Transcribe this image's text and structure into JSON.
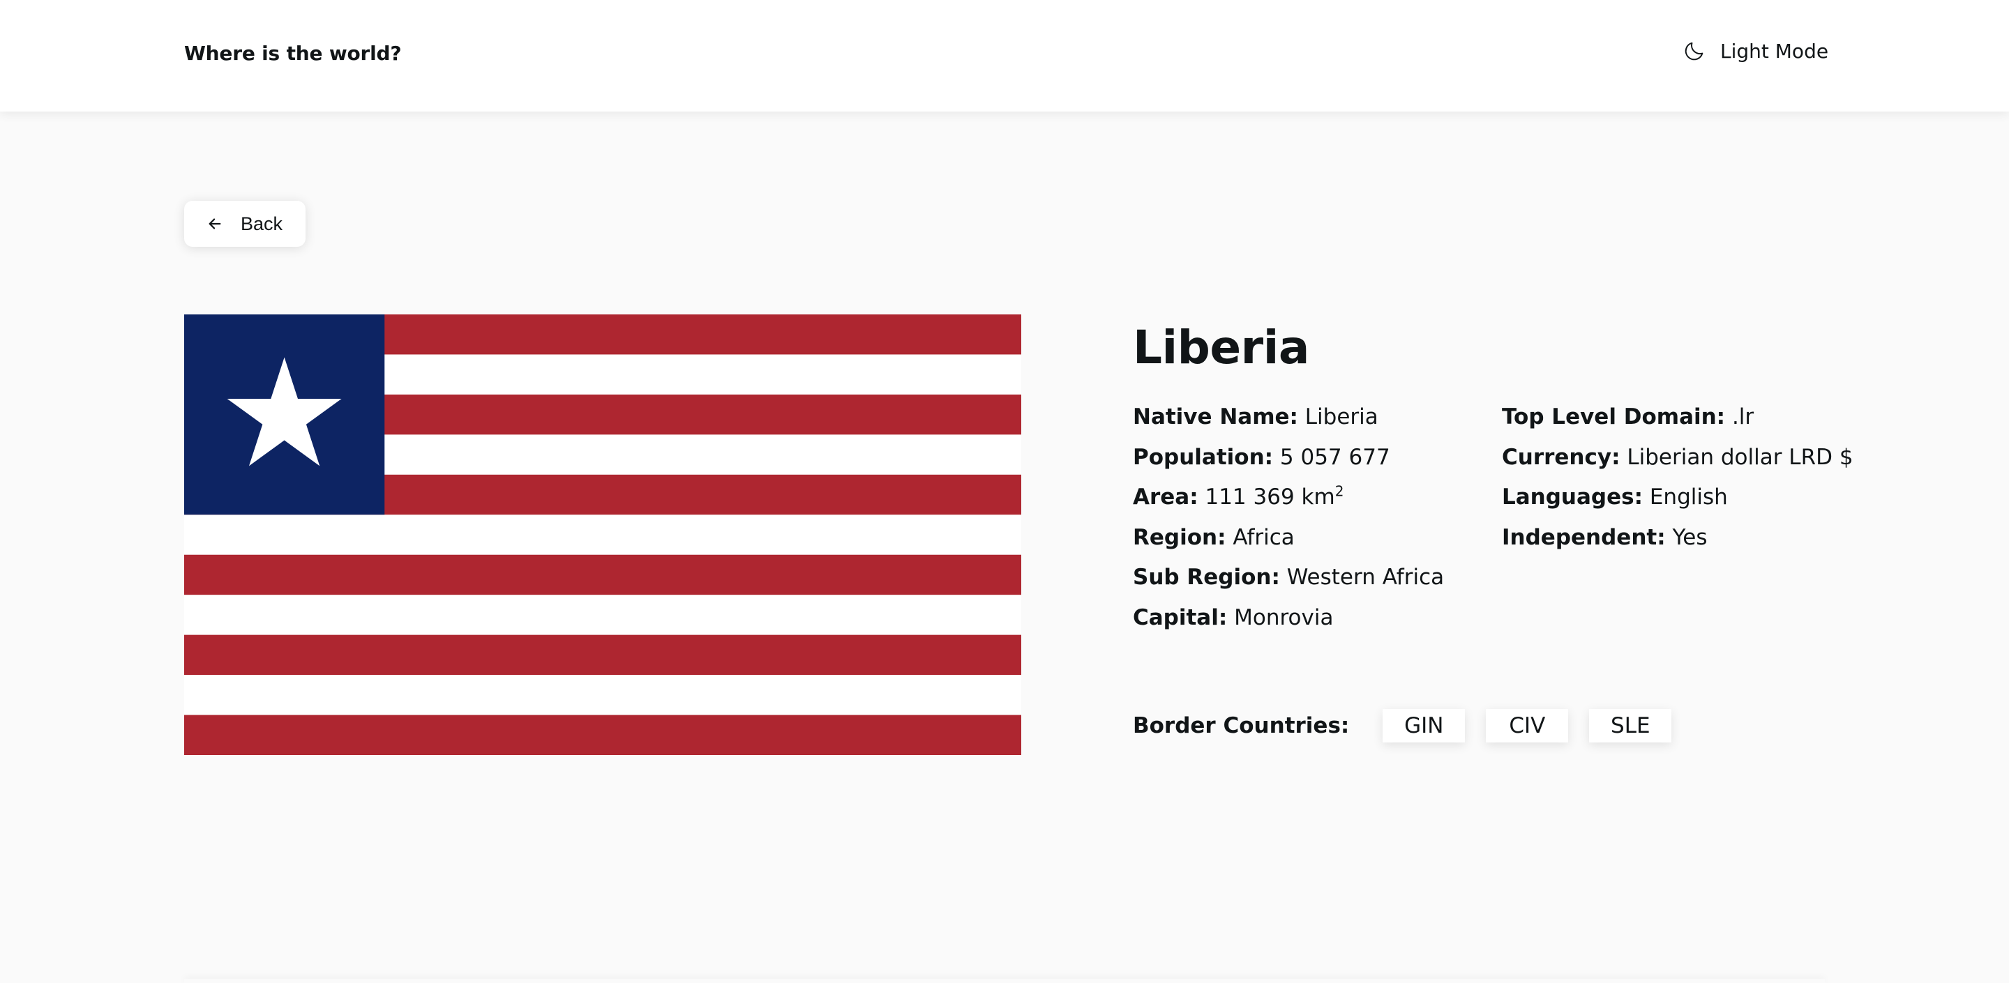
{
  "header": {
    "title": "Where is the world?",
    "mode_icon": "moon-icon",
    "mode_label": "Light Mode"
  },
  "back_button": {
    "icon": "arrow-left-icon",
    "label": "Back"
  },
  "country": {
    "name": "Liberia",
    "flag": {
      "stripe_red": "#ae2630",
      "stripe_white": "#ffffff",
      "canton_blue": "#0d2463",
      "star_color": "#ffffff"
    },
    "details_left": [
      {
        "key": "Native Name:",
        "value": "Liberia"
      },
      {
        "key": "Population:",
        "value": "5 057 677"
      },
      {
        "key": "Area:",
        "value": "111 369 km",
        "sup": "2"
      },
      {
        "key": "Region:",
        "value": "Africa"
      },
      {
        "key": "Sub Region:",
        "value": "Western Africa"
      },
      {
        "key": "Capital:",
        "value": "Monrovia"
      }
    ],
    "details_right": [
      {
        "key": "Top Level Domain:",
        "value": ".lr"
      },
      {
        "key": "Currency:",
        "value": "Liberian dollar LRD $"
      },
      {
        "key": "Languages:",
        "value": "English"
      },
      {
        "key": "Independent:",
        "value": "Yes"
      }
    ],
    "borders_label": "Border Countries:",
    "borders": [
      "GIN",
      "CIV",
      "SLE"
    ]
  }
}
